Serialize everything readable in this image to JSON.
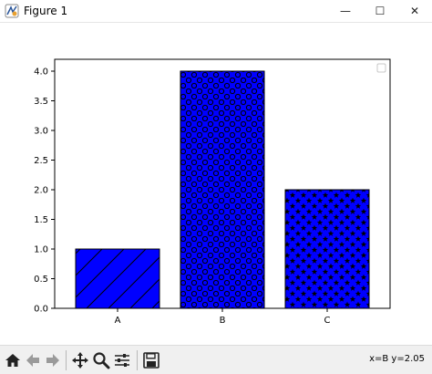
{
  "window": {
    "title": "Figure 1",
    "minimize_glyph": "—",
    "maximize_glyph": "☐",
    "close_glyph": "✕"
  },
  "toolbar": {
    "icons": [
      "home-icon",
      "back-arrow-icon",
      "forward-arrow-icon",
      "pan-icon",
      "zoom-icon",
      "subplots-icon",
      "save-icon"
    ],
    "coordinates": "x=B y=2.05"
  },
  "chart_data": {
    "type": "bar",
    "categories": [
      "A",
      "B",
      "C"
    ],
    "values": [
      1,
      4,
      2
    ],
    "hatches": [
      "/",
      "o",
      "*"
    ],
    "bar_color": "#0000ff",
    "ylim": [
      0,
      4.2
    ],
    "yticks": [
      "0.0",
      "0.5",
      "1.0",
      "1.5",
      "2.0",
      "2.5",
      "3.0",
      "3.5",
      "4.0"
    ],
    "legend": {
      "placement": "top-right",
      "entries": []
    },
    "grid": false
  }
}
